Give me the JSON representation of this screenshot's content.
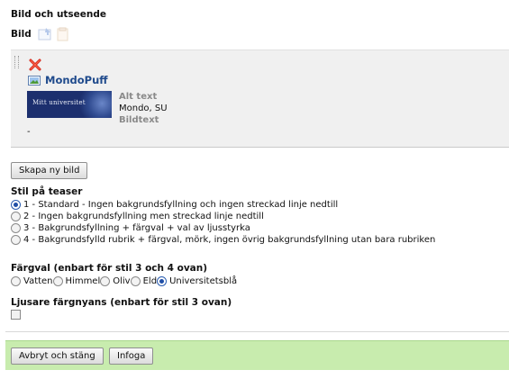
{
  "section_title": "Bild och utseende",
  "bild": {
    "label": "Bild"
  },
  "preview": {
    "title": "MondoPuff",
    "thumbnail_text": "Mitt universitet",
    "alt_label": "Alt text",
    "alt_value": "Mondo, SU",
    "caption_label": "Bildtext",
    "dash": "-"
  },
  "new_image_button": "Skapa ny bild",
  "teaser_style": {
    "title": "Stil på teaser",
    "options": [
      "1 - Standard - Ingen bakgrundsfyllning och ingen streckad linje nedtill",
      "2 - Ingen bakgrundsfyllning men streckad linje nedtill",
      "3 - Bakgrundsfyllning + färgval + val av ljusstyrka",
      "4 - Bakgrundsfylld rubrik + färgval, mörk, ingen övrig bakgrundsfyllning utan bara rubriken"
    ],
    "selected_index": 0
  },
  "color_choice": {
    "title": "Färgval (enbart för stil 3 och 4 ovan)",
    "options": [
      "Vatten",
      "Himmel",
      "Oliv",
      "Eld",
      "Universitetsblå"
    ],
    "selected_index": 4
  },
  "lighter_shade": {
    "title": "Ljusare färgnyans (enbart för stil 3 ovan)",
    "checked": false
  },
  "footer": {
    "cancel_label": "Avbryt och stäng",
    "insert_label": "Infoga"
  },
  "colors": {
    "link_blue": "#1f4a8c",
    "footer_green": "#c8ecae",
    "muted_label": "#8a8a8a",
    "thumb_navy": "#1c2f6e"
  }
}
